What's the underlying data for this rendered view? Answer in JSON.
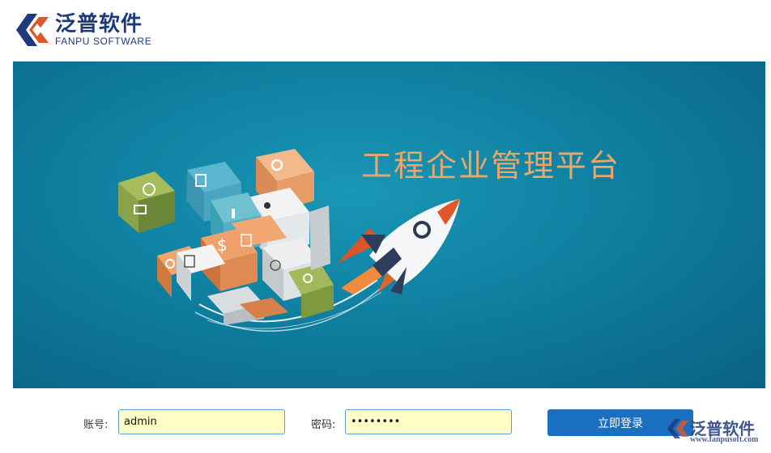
{
  "header": {
    "logo_cn": "泛普软件",
    "logo_en": "FANPU SOFTWARE"
  },
  "banner": {
    "title": "工程企业管理平台"
  },
  "login": {
    "username_label": "账号:",
    "username_value": "admin",
    "password_label": "密码:",
    "password_value": "password",
    "submit_label": "立即登录"
  },
  "watermark": {
    "cn": "泛普软件",
    "url": "www.fanpusoft.com"
  },
  "colors": {
    "brand": "#1e3a7a",
    "banner": "#0f7fa0",
    "title": "#e8a86a",
    "button": "#1a6fc0",
    "input_bg": "#ffffc8"
  }
}
